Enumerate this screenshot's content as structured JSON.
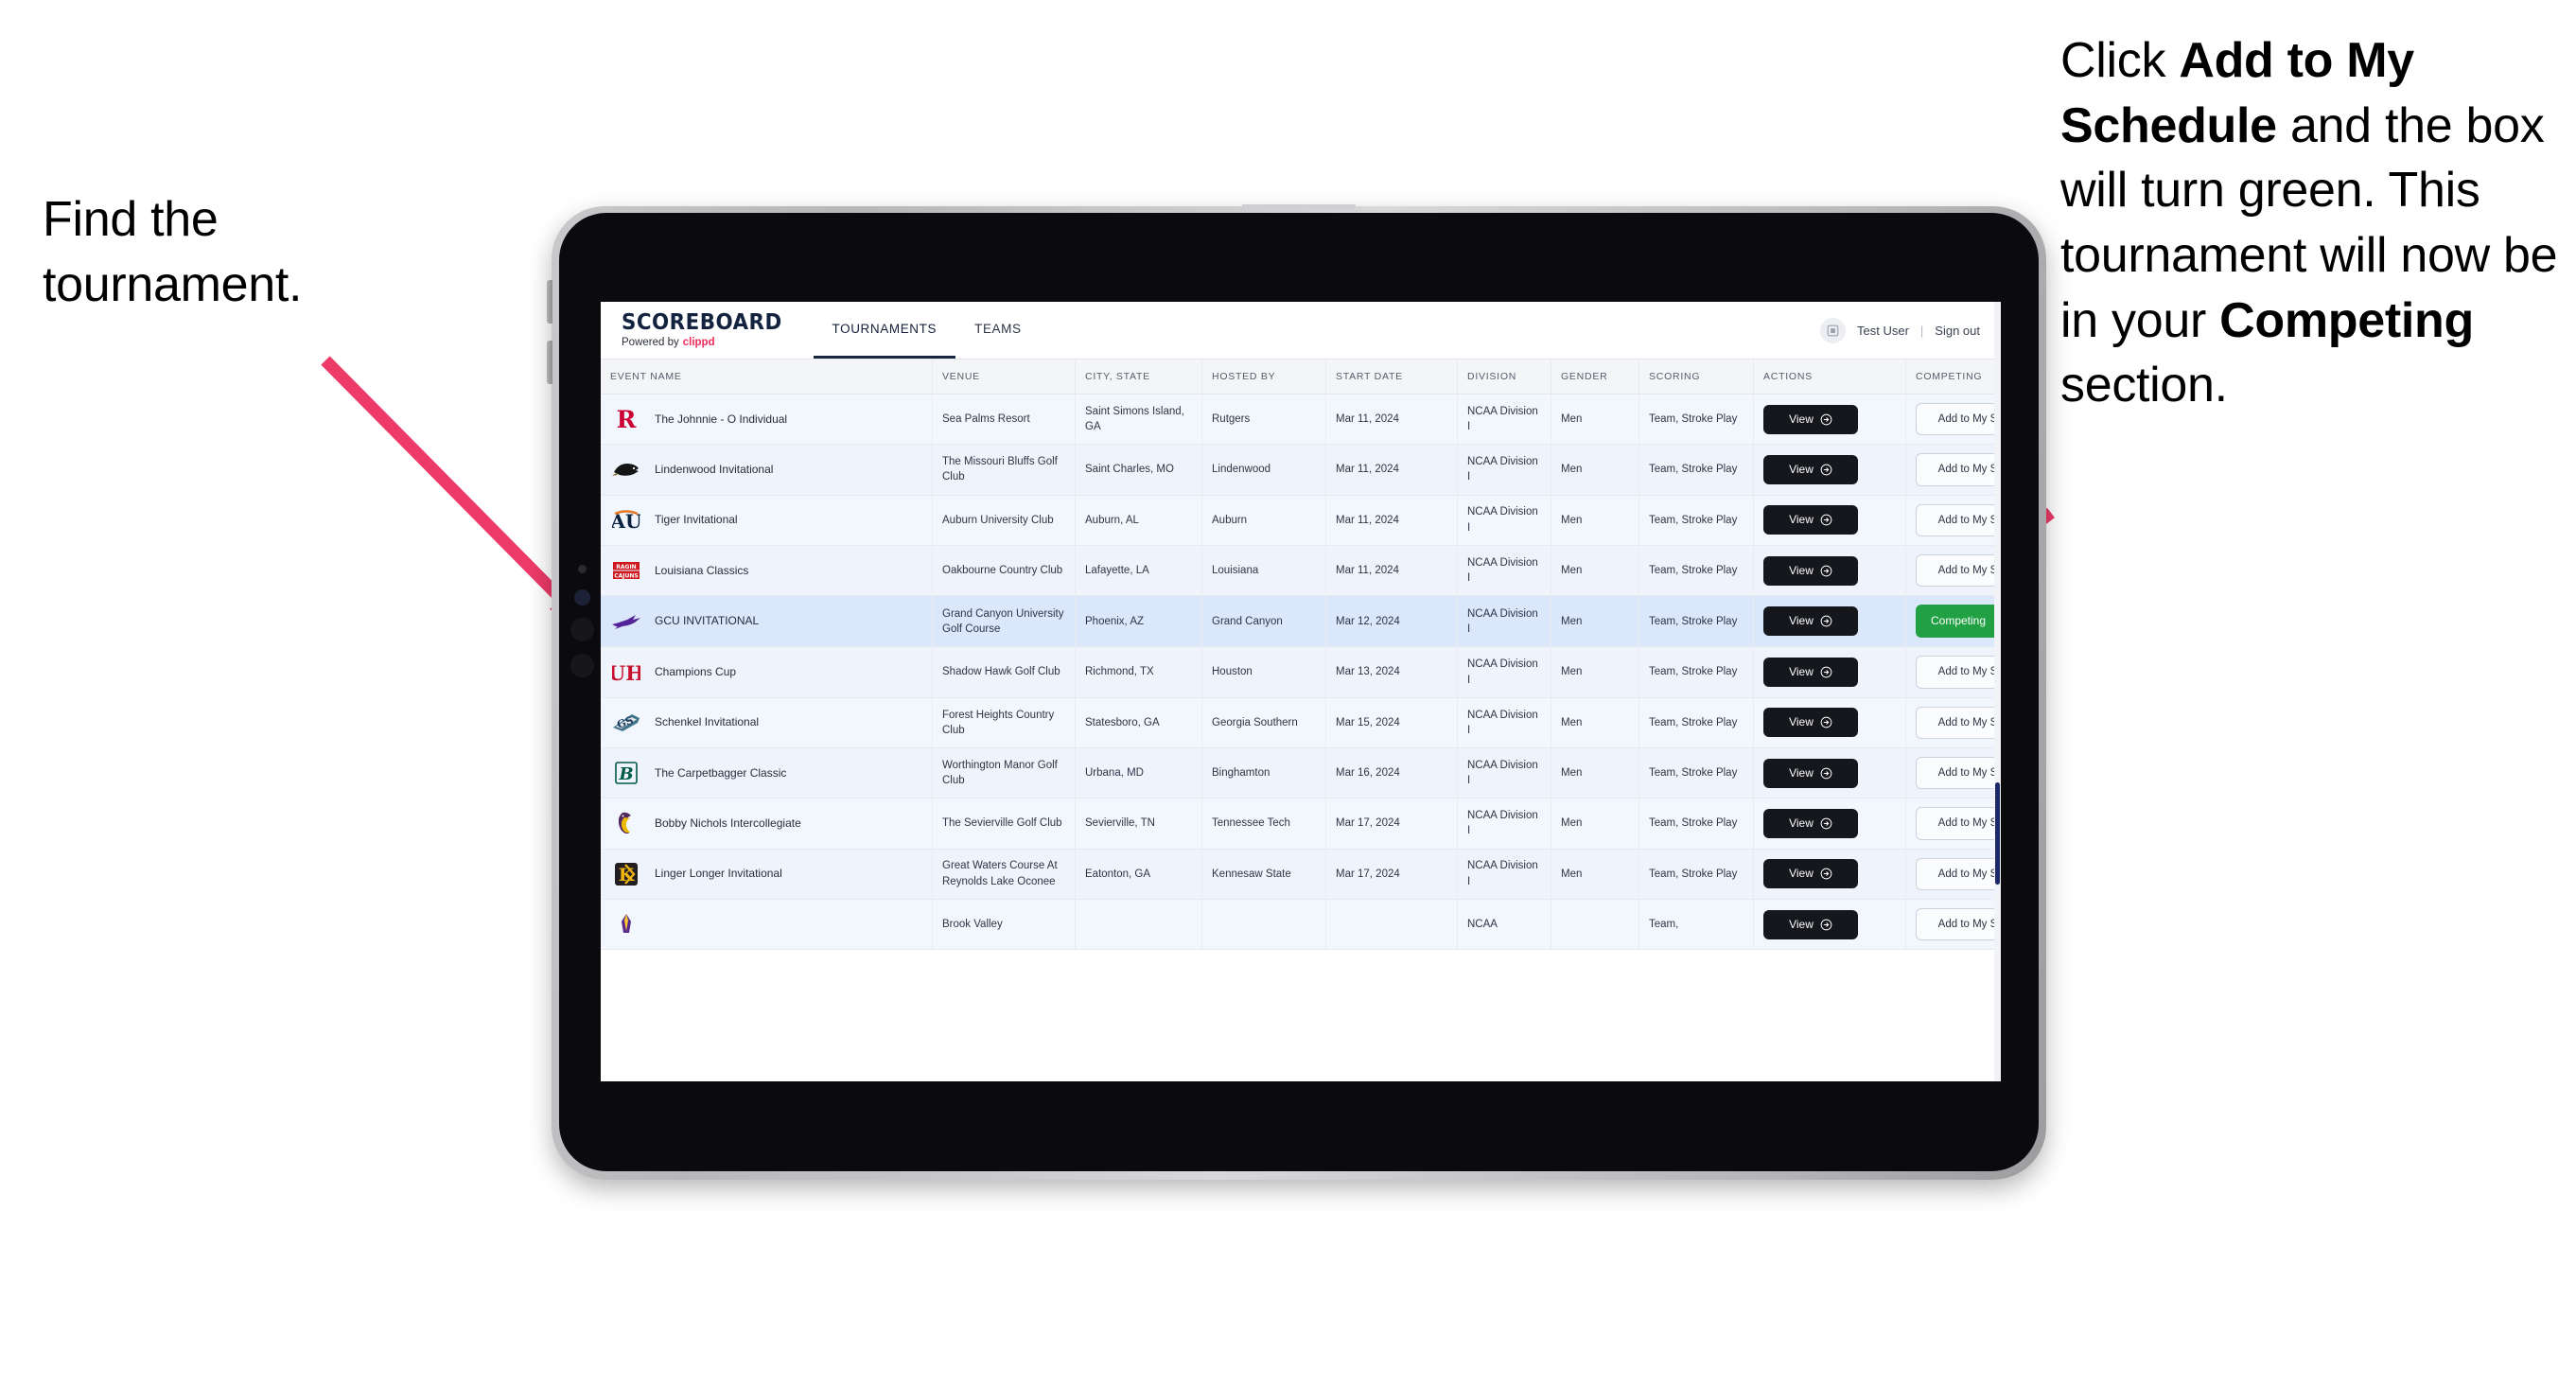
{
  "annotations": {
    "left": "Find the tournament.",
    "right_parts": [
      {
        "t": "Click ",
        "b": false
      },
      {
        "t": "Add to My Schedule",
        "b": true
      },
      {
        "t": " and the box will turn green. This tournament will now be in your ",
        "b": false
      },
      {
        "t": "Competing",
        "b": true
      },
      {
        "t": " section.",
        "b": false
      }
    ],
    "arrow_color": "#ED3A68"
  },
  "app": {
    "brand": {
      "title": "SCOREBOARD",
      "powered_prefix": "Powered by",
      "powered_name": "clippd"
    },
    "nav": [
      {
        "label": "TOURNAMENTS",
        "active": true
      },
      {
        "label": "TEAMS",
        "active": false
      }
    ],
    "header_right": {
      "user": "Test User",
      "separator": "|",
      "signout": "Sign out"
    }
  },
  "table": {
    "columns": [
      "EVENT NAME",
      "VENUE",
      "CITY, STATE",
      "HOSTED BY",
      "START DATE",
      "DIVISION",
      "GENDER",
      "SCORING",
      "ACTIONS",
      "COMPETING"
    ],
    "view_label": "View",
    "add_label": "Add to My Schedule",
    "competing_label": "Competing",
    "rows": [
      {
        "logo": "rutgers",
        "event": "The Johnnie - O Individual",
        "venue": "Sea Palms Resort",
        "city": "Saint Simons Island, GA",
        "host": "Rutgers",
        "date": "Mar 11, 2024",
        "division": "NCAA Division I",
        "gender": "Men",
        "scoring": "Team, Stroke Play",
        "competing": false
      },
      {
        "logo": "lindenwood",
        "event": "Lindenwood Invitational",
        "venue": "The Missouri Bluffs Golf Club",
        "city": "Saint Charles, MO",
        "host": "Lindenwood",
        "date": "Mar 11, 2024",
        "division": "NCAA Division I",
        "gender": "Men",
        "scoring": "Team, Stroke Play",
        "competing": false
      },
      {
        "logo": "auburn",
        "event": "Tiger Invitational",
        "venue": "Auburn University Club",
        "city": "Auburn, AL",
        "host": "Auburn",
        "date": "Mar 11, 2024",
        "division": "NCAA Division I",
        "gender": "Men",
        "scoring": "Team, Stroke Play",
        "competing": false
      },
      {
        "logo": "louisiana",
        "event": "Louisiana Classics",
        "venue": "Oakbourne Country Club",
        "city": "Lafayette, LA",
        "host": "Louisiana",
        "date": "Mar 11, 2024",
        "division": "NCAA Division I",
        "gender": "Men",
        "scoring": "Team, Stroke Play",
        "competing": false
      },
      {
        "logo": "gcu",
        "event": "GCU INVITATIONAL",
        "venue": "Grand Canyon University Golf Course",
        "city": "Phoenix, AZ",
        "host": "Grand Canyon",
        "date": "Mar 12, 2024",
        "division": "NCAA Division I",
        "gender": "Men",
        "scoring": "Team, Stroke Play",
        "competing": true
      },
      {
        "logo": "houston",
        "event": "Champions Cup",
        "venue": "Shadow Hawk Golf Club",
        "city": "Richmond, TX",
        "host": "Houston",
        "date": "Mar 13, 2024",
        "division": "NCAA Division I",
        "gender": "Men",
        "scoring": "Team, Stroke Play",
        "competing": false
      },
      {
        "logo": "georgiasouthern",
        "event": "Schenkel Invitational",
        "venue": "Forest Heights Country Club",
        "city": "Statesboro, GA",
        "host": "Georgia Southern",
        "date": "Mar 15, 2024",
        "division": "NCAA Division I",
        "gender": "Men",
        "scoring": "Team, Stroke Play",
        "competing": false
      },
      {
        "logo": "binghamton",
        "event": "The Carpetbagger Classic",
        "venue": "Worthington Manor Golf Club",
        "city": "Urbana, MD",
        "host": "Binghamton",
        "date": "Mar 16, 2024",
        "division": "NCAA Division I",
        "gender": "Men",
        "scoring": "Team, Stroke Play",
        "competing": false
      },
      {
        "logo": "tennesseetech",
        "event": "Bobby Nichols Intercollegiate",
        "venue": "The Sevierville Golf Club",
        "city": "Sevierville, TN",
        "host": "Tennessee Tech",
        "date": "Mar 17, 2024",
        "division": "NCAA Division I",
        "gender": "Men",
        "scoring": "Team, Stroke Play",
        "competing": false
      },
      {
        "logo": "kennesaw",
        "event": "Linger Longer Invitational",
        "venue": "Great Waters Course At Reynolds Lake Oconee",
        "city": "Eatonton, GA",
        "host": "Kennesaw State",
        "date": "Mar 17, 2024",
        "division": "NCAA Division I",
        "gender": "Men",
        "scoring": "Team, Stroke Play",
        "competing": false
      },
      {
        "logo": "eastcarolina",
        "event": "",
        "venue": "Brook Valley",
        "city": "",
        "host": "",
        "date": "",
        "division": "NCAA",
        "gender": "",
        "scoring": "Team,",
        "competing": false
      }
    ]
  }
}
